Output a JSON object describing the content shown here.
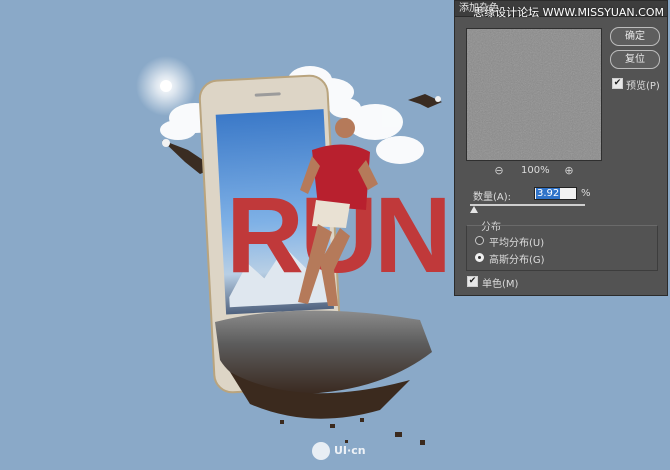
{
  "watermark": {
    "top_text": "思缘设计论坛 WWW.MISSYUAN.COM",
    "bottom_text": "UI·cn"
  },
  "artwork": {
    "headline": "RUN"
  },
  "dialog": {
    "title": "添加杂色",
    "ok_label": "确定",
    "reset_label": "复位",
    "preview_label": "预览(P)",
    "preview_checked": true,
    "zoom_level": "100%",
    "amount_label": "数量(A):",
    "amount_value": "3.92",
    "amount_unit": "%",
    "distribution": {
      "group_label": "分布",
      "options": [
        {
          "label": "平均分布(U)",
          "selected": false
        },
        {
          "label": "高斯分布(G)",
          "selected": true
        }
      ]
    },
    "monochromatic_label": "单色(M)",
    "monochromatic_checked": true
  },
  "colors": {
    "canvas_bg": "#8aa9c8",
    "dialog_bg": "#535353",
    "headline": "#c0393a",
    "selection": "#2f73c9"
  }
}
